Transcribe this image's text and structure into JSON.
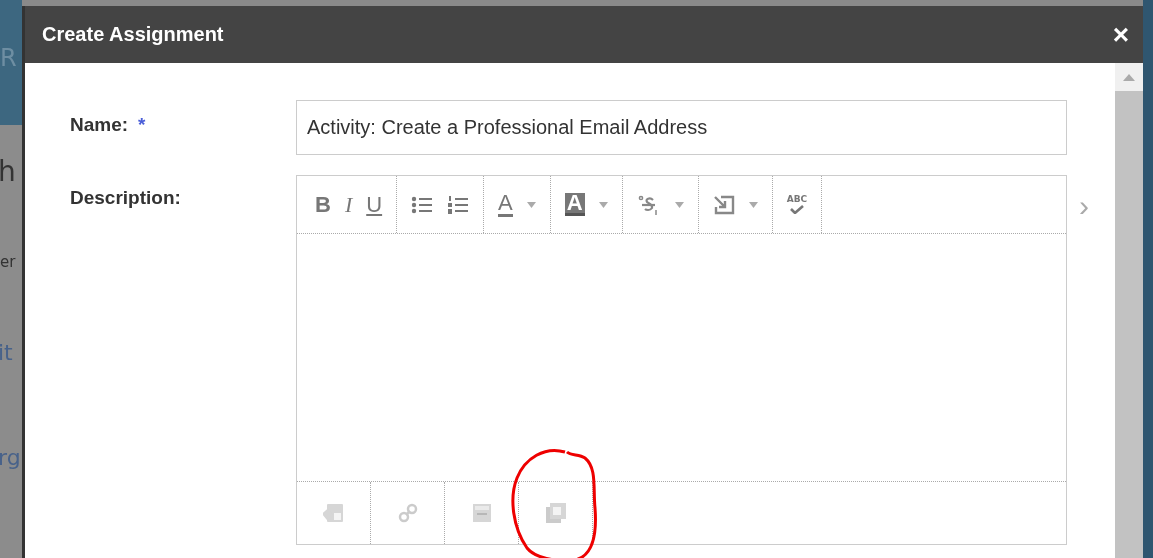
{
  "background_fragments": [
    {
      "text": "R",
      "kind": "header"
    },
    {
      "text": "h",
      "kind": "heading"
    },
    {
      "text": "er",
      "kind": "tab"
    },
    {
      "text": "it",
      "kind": "link"
    },
    {
      "text": "rg",
      "kind": "link"
    }
  ],
  "dialog": {
    "title": "Create Assignment",
    "close": "×"
  },
  "form": {
    "name_label": "Name:",
    "required_mark": "*",
    "name_value": "Activity: Create a Professional Email Address",
    "description_label": "Description:"
  },
  "toolbar": [
    {
      "kind": "bold",
      "label": "B"
    },
    {
      "kind": "italic",
      "label": "I"
    },
    {
      "kind": "underline",
      "label": "U"
    },
    {
      "kind": "sep"
    },
    {
      "kind": "bullets"
    },
    {
      "kind": "numbers"
    },
    {
      "kind": "sep"
    },
    {
      "kind": "fontcolor",
      "label": "A"
    },
    {
      "kind": "caret"
    },
    {
      "kind": "sep"
    },
    {
      "kind": "bgcolor",
      "label": "A"
    },
    {
      "kind": "caret"
    },
    {
      "kind": "sep"
    },
    {
      "kind": "script"
    },
    {
      "kind": "caret"
    },
    {
      "kind": "sep"
    },
    {
      "kind": "insert"
    },
    {
      "kind": "caret"
    },
    {
      "kind": "sep"
    },
    {
      "kind": "spell",
      "label": "ABC"
    },
    {
      "kind": "sep"
    }
  ],
  "bottom_toolbar": [
    {
      "kind": "image",
      "disabled": true
    },
    {
      "kind": "link",
      "disabled": true
    },
    {
      "kind": "media",
      "disabled": true
    },
    {
      "kind": "embed",
      "disabled": true
    }
  ],
  "more": "›"
}
